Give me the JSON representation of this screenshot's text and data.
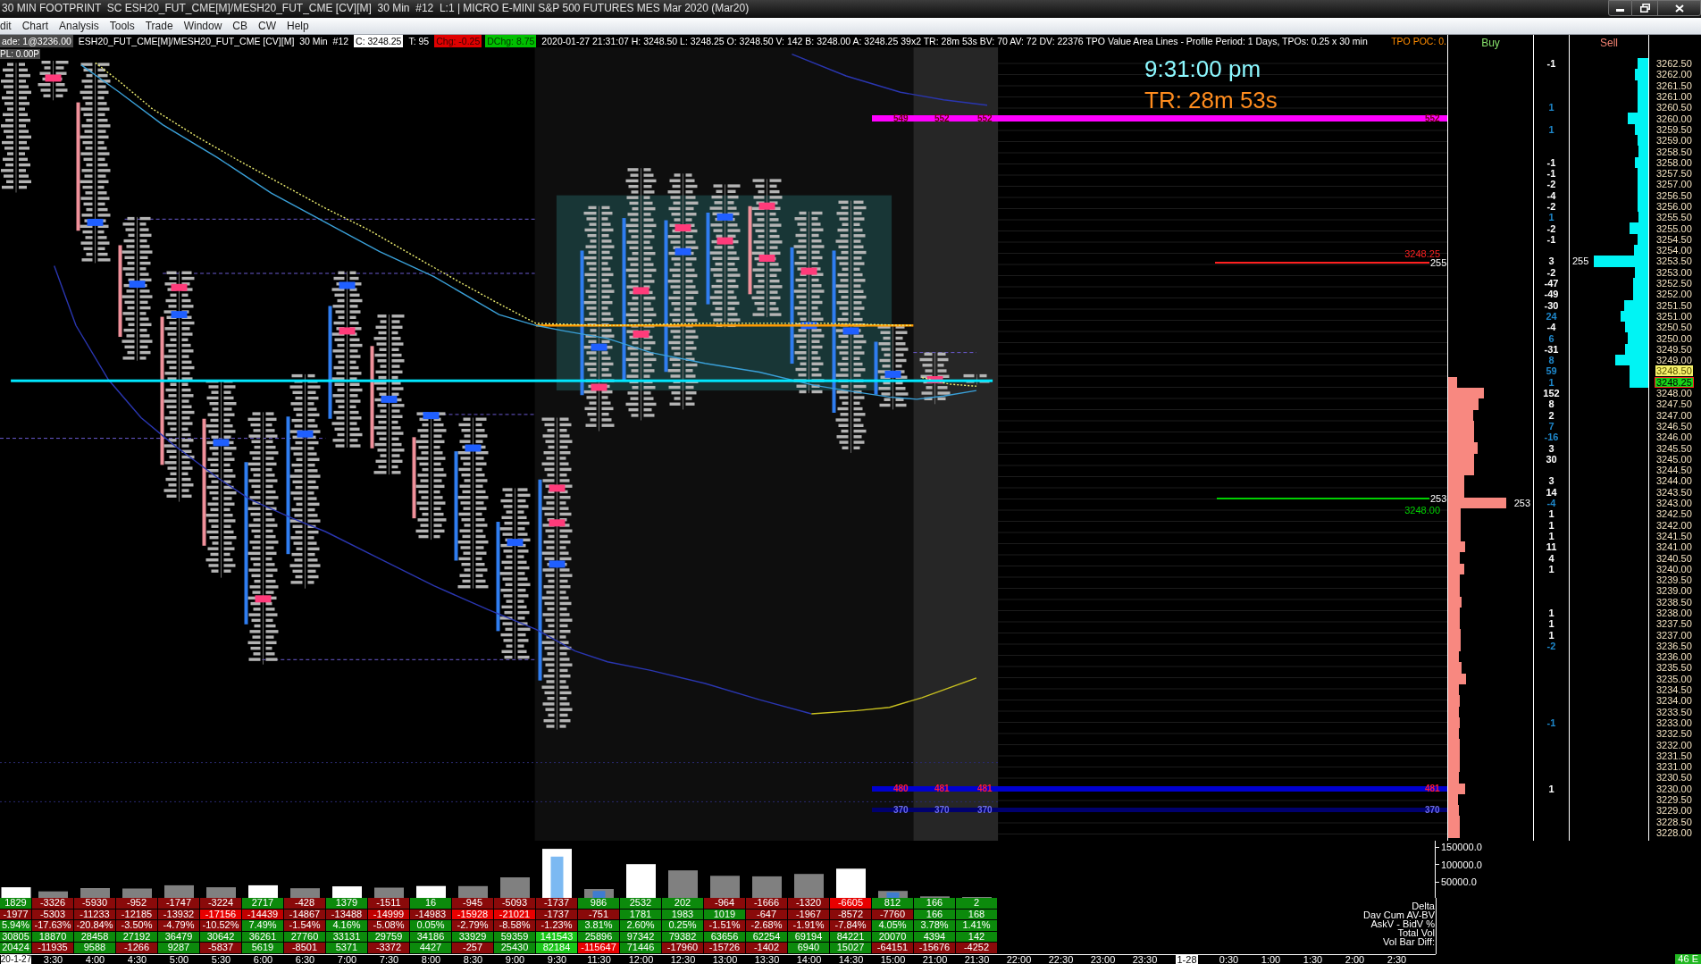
{
  "window": {
    "title": "30 MIN FOOTPRINT  SC ESH20_FUT_CME[M]/MESH20_FUT_CME [CV][M]  30 Min  #12  L:1 | MICRO E-MINI S&P 500 FUTURES MES Mar 2020 (Mar20)"
  },
  "menu": [
    "dit",
    "Chart",
    "Analysis",
    "Tools",
    "Trade",
    "Window",
    "CB",
    "CW",
    "Help"
  ],
  "chart_header": [
    {
      "kind": "trade",
      "text": "ade: 1@3236.00"
    },
    {
      "kind": "plain",
      "text": "ESH20_FUT_CME[M]/MESH20_FUT_CME [CV][M]  30 Min  #12"
    },
    {
      "kind": "close",
      "text": "C: 3248.25"
    },
    {
      "kind": "plain",
      "text": "T: 95"
    },
    {
      "kind": "down",
      "text": "Chg: -0.25"
    },
    {
      "kind": "up",
      "text": "DChg: 8.75"
    },
    {
      "kind": "plain",
      "text": "2020-01-27 21:31:07 H: 3248.50 L: 3248.25 O: 3248.50 V: 142 B: 3248.00 A: 3248.25 39x2 TR: 28m 53s BV: 70 AV: 72 DV: 22376 TPO Value Area Lines - Profile Period: 1 Days, TPOs: 0.25 x 30 min"
    },
    {
      "kind": "poc",
      "text": "TPO POC: 0."
    }
  ],
  "chart": {
    "pl": "PL: 0.00P",
    "clock": "9:31:00 pm",
    "timer": "TR: 28m 53s",
    "zones": [
      {
        "kind": "high",
        "color": "#ff00ff",
        "labels": [
          "549",
          "552",
          "552",
          "552"
        ]
      },
      {
        "kind": "low",
        "color": "#0000d0",
        "labels": [
          "480",
          "481",
          "481",
          "481"
        ]
      },
      {
        "kind": "lower",
        "color": "#00006e",
        "labels": [
          "370",
          "370",
          "370",
          "370"
        ]
      }
    ],
    "levels": [
      {
        "kind": "upper",
        "price": "3248.25",
        "count": "255",
        "color": "#ff2020"
      },
      {
        "kind": "lower",
        "price": "3248.00",
        "count": "253",
        "color": "#00d000"
      }
    ]
  },
  "ladder": {
    "buy_header": "Buy",
    "sell_header": "Sell",
    "rows": [
      {
        "price": "3262.50",
        "kind": "price",
        "sell": {
          "level": 0.14
        },
        "delta": {
          "text": "-1",
          "color": "#ffffff"
        }
      },
      {
        "price": "3262.00",
        "kind": "price",
        "sell": {
          "level": 0.17
        }
      },
      {
        "price": "3261.50",
        "kind": "price",
        "sell": {
          "level": 0.14
        }
      },
      {
        "price": "3261.00",
        "kind": "price",
        "sell": {
          "level": 0.14
        }
      },
      {
        "price": "3260.50",
        "kind": "price",
        "sell": {
          "level": 0.14
        },
        "delta": {
          "text": "1",
          "color": "#1e88cc"
        }
      },
      {
        "price": "3260.00",
        "kind": "price",
        "sell": {
          "level": 0.26
        }
      },
      {
        "price": "3259.50",
        "kind": "price",
        "sell": {
          "level": 0.17
        },
        "delta": {
          "text": "1",
          "color": "#1e88cc"
        }
      },
      {
        "price": "3259.00",
        "kind": "price",
        "sell": {
          "level": 0.14
        }
      },
      {
        "price": "3258.50",
        "kind": "price",
        "sell": {
          "level": 0.13
        }
      },
      {
        "price": "3258.00",
        "kind": "price",
        "sell": {
          "level": 0.17
        },
        "delta": {
          "text": "-1",
          "color": "#ffffff"
        }
      },
      {
        "price": "3257.50",
        "kind": "price",
        "sell": {
          "level": 0.14
        },
        "delta": {
          "text": "-1",
          "color": "#ffffff"
        }
      },
      {
        "price": "3257.00",
        "kind": "price",
        "sell": {
          "level": 0.14
        },
        "delta": {
          "text": "-2",
          "color": "#ffffff"
        }
      },
      {
        "price": "3256.50",
        "kind": "price",
        "sell": {
          "level": 0.14
        },
        "delta": {
          "text": "-4",
          "color": "#ffffff"
        }
      },
      {
        "price": "3256.00",
        "kind": "price",
        "sell": {
          "level": 0.14
        },
        "delta": {
          "text": "-2",
          "color": "#ffffff"
        }
      },
      {
        "price": "3255.50",
        "kind": "price",
        "sell": {
          "level": 0.13
        },
        "delta": {
          "text": "1",
          "color": "#1e88cc"
        }
      },
      {
        "price": "3255.00",
        "kind": "price",
        "sell": {
          "level": 0.24
        },
        "delta": {
          "text": "-2",
          "color": "#ffffff"
        }
      },
      {
        "price": "3254.50",
        "kind": "price",
        "sell": {
          "level": 0.14
        },
        "delta": {
          "text": "-1",
          "color": "#ffffff"
        }
      },
      {
        "price": "3254.00",
        "kind": "price",
        "sell": {
          "level": 0.18
        }
      },
      {
        "price": "3253.50",
        "kind": "price",
        "sell": {
          "level": 0.69
        },
        "sell_volume": "255",
        "delta": {
          "text": "3",
          "color": "#ffffff"
        }
      },
      {
        "price": "3253.00",
        "kind": "price",
        "sell": {
          "level": 0.17
        },
        "delta": {
          "text": "-2",
          "color": "#ffffff"
        }
      },
      {
        "price": "3252.50",
        "kind": "price",
        "sell": {
          "level": 0.19
        },
        "delta": {
          "text": "-47",
          "color": "#ffffff"
        }
      },
      {
        "price": "3252.00",
        "kind": "price",
        "sell": {
          "level": 0.19
        },
        "delta": {
          "text": "-49",
          "color": "#ffffff"
        }
      },
      {
        "price": "3251.50",
        "kind": "price",
        "sell": {
          "level": 0.31
        },
        "delta": {
          "text": "-30",
          "color": "#ffffff"
        }
      },
      {
        "price": "3251.00",
        "kind": "price",
        "sell": {
          "level": 0.35
        },
        "delta": {
          "text": "24",
          "color": "#1e88cc"
        }
      },
      {
        "price": "3250.50",
        "kind": "price",
        "sell": {
          "level": 0.3
        },
        "delta": {
          "text": "-4",
          "color": "#ffffff"
        }
      },
      {
        "price": "3250.00",
        "kind": "price",
        "sell": {
          "level": 0.26
        },
        "delta": {
          "text": "6",
          "color": "#1e88cc"
        }
      },
      {
        "price": "3249.50",
        "kind": "price",
        "sell": {
          "level": 0.29
        },
        "delta": {
          "text": "-31",
          "color": "#ffffff"
        }
      },
      {
        "price": "3249.00",
        "kind": "price",
        "sell": {
          "level": 0.42
        },
        "delta": {
          "text": "8",
          "color": "#1e88cc"
        }
      },
      {
        "price": "3248.50",
        "kind": "ask",
        "sell": {
          "level": 0.24
        },
        "delta": {
          "text": "59",
          "color": "#1e88cc"
        }
      },
      {
        "price": "3248.25",
        "kind": "last",
        "sell": {
          "level": 0.24
        },
        "buy": {
          "level": 0.1
        },
        "delta": {
          "text": "1",
          "color": "#1e88cc"
        }
      },
      {
        "price": "3248.00",
        "kind": "price",
        "buy": {
          "level": 0.42
        },
        "delta": {
          "text": "152",
          "color": "#ffffff"
        }
      },
      {
        "price": "3247.50",
        "kind": "price",
        "buy": {
          "level": 0.36
        },
        "delta": {
          "text": "8",
          "color": "#ffffff"
        }
      },
      {
        "price": "3247.00",
        "kind": "price",
        "buy": {
          "level": 0.29
        },
        "delta": {
          "text": "2",
          "color": "#ffffff"
        }
      },
      {
        "price": "3246.50",
        "kind": "price",
        "buy": {
          "level": 0.31
        },
        "delta": {
          "text": "7",
          "color": "#1e88cc"
        }
      },
      {
        "price": "3246.00",
        "kind": "price",
        "buy": {
          "level": 0.31
        },
        "delta": {
          "text": "-16",
          "color": "#1e88cc"
        }
      },
      {
        "price": "3245.50",
        "kind": "price",
        "buy": {
          "level": 0.35
        },
        "delta": {
          "text": "3",
          "color": "#ffffff"
        }
      },
      {
        "price": "3245.00",
        "kind": "price",
        "buy": {
          "level": 0.31
        },
        "delta": {
          "text": "30",
          "color": "#ffffff"
        }
      },
      {
        "price": "3244.50",
        "kind": "price",
        "buy": {
          "level": 0.31
        }
      },
      {
        "price": "3244.00",
        "kind": "price",
        "buy": {
          "level": 0.19
        },
        "delta": {
          "text": "3",
          "color": "#ffffff"
        }
      },
      {
        "price": "3243.50",
        "kind": "price",
        "buy": {
          "level": 0.19
        },
        "delta": {
          "text": "14",
          "color": "#ffffff"
        }
      },
      {
        "price": "3243.00",
        "kind": "price",
        "buy": {
          "level": 0.68
        },
        "buy_volume": "253",
        "delta": {
          "text": "-4",
          "color": "#1e88cc"
        }
      },
      {
        "price": "3242.50",
        "kind": "price",
        "buy": {
          "level": 0.15
        },
        "delta": {
          "text": "1",
          "color": "#ffffff"
        }
      },
      {
        "price": "3242.00",
        "kind": "price",
        "buy": {
          "level": 0.15
        },
        "delta": {
          "text": "1",
          "color": "#ffffff"
        }
      },
      {
        "price": "3241.50",
        "kind": "price",
        "buy": {
          "level": 0.15
        },
        "delta": {
          "text": "1",
          "color": "#ffffff"
        }
      },
      {
        "price": "3241.00",
        "kind": "price",
        "buy": {
          "level": 0.2
        },
        "delta": {
          "text": "11",
          "color": "#ffffff"
        }
      },
      {
        "price": "3240.50",
        "kind": "price",
        "buy": {
          "level": 0.14
        },
        "delta": {
          "text": "4",
          "color": "#ffffff"
        }
      },
      {
        "price": "3240.00",
        "kind": "price",
        "buy": {
          "level": 0.19
        },
        "delta": {
          "text": "1",
          "color": "#ffffff"
        }
      },
      {
        "price": "3239.50",
        "kind": "price",
        "buy": {
          "level": 0.14
        }
      },
      {
        "price": "3239.00",
        "kind": "price",
        "buy": {
          "level": 0.14
        }
      },
      {
        "price": "3238.50",
        "kind": "price",
        "buy": {
          "level": 0.16
        }
      },
      {
        "price": "3238.00",
        "kind": "price",
        "buy": {
          "level": 0.14
        },
        "delta": {
          "text": "1",
          "color": "#ffffff"
        }
      },
      {
        "price": "3237.50",
        "kind": "price",
        "buy": {
          "level": 0.14
        },
        "delta": {
          "text": "1",
          "color": "#ffffff"
        }
      },
      {
        "price": "3237.00",
        "kind": "price",
        "buy": {
          "level": 0.15
        },
        "delta": {
          "text": "1",
          "color": "#ffffff"
        }
      },
      {
        "price": "3236.50",
        "kind": "price",
        "buy": {
          "level": 0.15
        },
        "delta": {
          "text": "-2",
          "color": "#1e88cc"
        }
      },
      {
        "price": "3236.00",
        "kind": "price",
        "buy": {
          "level": 0.13
        }
      },
      {
        "price": "3235.50",
        "kind": "price",
        "buy": {
          "level": 0.16
        }
      },
      {
        "price": "3235.00",
        "kind": "price",
        "buy": {
          "level": 0.21
        }
      },
      {
        "price": "3234.50",
        "kind": "price",
        "buy": {
          "level": 0.13
        }
      },
      {
        "price": "3234.00",
        "kind": "price",
        "buy": {
          "level": 0.14
        }
      },
      {
        "price": "3233.50",
        "kind": "price",
        "buy": {
          "level": 0.13
        }
      },
      {
        "price": "3233.00",
        "kind": "price",
        "buy": {
          "level": 0.14
        },
        "delta": {
          "text": "-1",
          "color": "#1e88cc"
        }
      },
      {
        "price": "3232.50",
        "kind": "price",
        "buy": {
          "level": 0.13
        }
      },
      {
        "price": "3232.00",
        "kind": "price",
        "buy": {
          "level": 0.14
        }
      },
      {
        "price": "3231.50",
        "kind": "price",
        "buy": {
          "level": 0.14
        }
      },
      {
        "price": "3231.00",
        "kind": "price",
        "buy": {
          "level": 0.14
        }
      },
      {
        "price": "3230.50",
        "kind": "price",
        "buy": {
          "level": 0.13
        }
      },
      {
        "price": "3230.00",
        "kind": "price",
        "buy": {
          "level": 0.2
        },
        "delta": {
          "text": "1",
          "color": "#ffffff"
        }
      },
      {
        "price": "3229.50",
        "kind": "price",
        "buy": {
          "level": 0.12
        }
      },
      {
        "price": "3229.00",
        "kind": "price",
        "buy": {
          "level": 0.13
        }
      },
      {
        "price": "3228.50",
        "kind": "price",
        "buy": {
          "level": 0.14
        }
      },
      {
        "price": "3228.00",
        "kind": "price",
        "buy": {
          "level": 0.14
        }
      }
    ]
  },
  "volume_axis": [
    "150000.0",
    "100000.0",
    "50000.0"
  ],
  "table": {
    "rows": [
      {
        "label": "Delta",
        "cells": [
          {
            "text": "1829",
            "color": "#0c8a0c"
          },
          {
            "text": "-3326",
            "color": "#8a0a0a"
          },
          {
            "text": "-5930",
            "color": "#8a0a0a"
          },
          {
            "text": "-952",
            "color": "#8a0a0a"
          },
          {
            "text": "-1747",
            "color": "#8a0a0a"
          },
          {
            "text": "-3224",
            "color": "#8a0a0a"
          },
          {
            "text": "2717",
            "color": "#0c8a0c"
          },
          {
            "text": "-428",
            "color": "#8a0a0a"
          },
          {
            "text": "1379",
            "color": "#0c8a0c"
          },
          {
            "text": "-1511",
            "color": "#8a0a0a"
          },
          {
            "text": "16",
            "color": "#0c8a0c"
          },
          {
            "text": "-945",
            "color": "#8a0a0a"
          },
          {
            "text": "-5093",
            "color": "#8a0a0a"
          },
          {
            "text": "-1737",
            "color": "#8a0a0a"
          },
          {
            "text": "986",
            "color": "#0c8a0c"
          },
          {
            "text": "2532",
            "color": "#0c8a0c"
          },
          {
            "text": "202",
            "color": "#0c8a0c"
          },
          {
            "text": "-964",
            "color": "#8a0a0a"
          },
          {
            "text": "-1666",
            "color": "#8a0a0a"
          },
          {
            "text": "-1320",
            "color": "#8a0a0a"
          },
          {
            "text": "-6605",
            "color": "#e80000"
          },
          {
            "text": "812",
            "color": "#0c8a0c"
          },
          {
            "text": "166",
            "color": "#0c8a0c"
          },
          {
            "text": "2",
            "color": "#0c8a0c"
          }
        ]
      },
      {
        "label": "Dav Cum AV-BV",
        "cells": [
          {
            "text": "-1977",
            "color": "#8a0a0a"
          },
          {
            "text": "-5303",
            "color": "#8a0a0a"
          },
          {
            "text": "-11233",
            "color": "#8a0a0a"
          },
          {
            "text": "-12185",
            "color": "#8a0a0a"
          },
          {
            "text": "-13932",
            "color": "#8a0a0a"
          },
          {
            "text": "-17156",
            "color": "#e80000"
          },
          {
            "text": "-14439",
            "color": "#c00000"
          },
          {
            "text": "-14867",
            "color": "#8a0a0a"
          },
          {
            "text": "-13488",
            "color": "#8a0a0a"
          },
          {
            "text": "-14999",
            "color": "#c00000"
          },
          {
            "text": "-14983",
            "color": "#8a0a0a"
          },
          {
            "text": "-15928",
            "color": "#e80000"
          },
          {
            "text": "-21021",
            "color": "#e80000"
          },
          {
            "text": "-1737",
            "color": "#8a0a0a"
          },
          {
            "text": "-751",
            "color": "#8a0a0a"
          },
          {
            "text": "1781",
            "color": "#0c8a0c"
          },
          {
            "text": "1983",
            "color": "#0c8a0c"
          },
          {
            "text": "1019",
            "color": "#0c8a0c"
          },
          {
            "text": "-647",
            "color": "#8a0a0a"
          },
          {
            "text": "-1967",
            "color": "#8a0a0a"
          },
          {
            "text": "-8572",
            "color": "#8a0a0a"
          },
          {
            "text": "-7760",
            "color": "#8a0a0a"
          },
          {
            "text": "166",
            "color": "#0c8a0c"
          },
          {
            "text": "168",
            "color": "#0c8a0c"
          }
        ]
      },
      {
        "label": "AskV - BidV %",
        "cells": [
          {
            "text": "5.94%",
            "color": "#0c8a0c"
          },
          {
            "text": "-17.63%",
            "color": "#8a0a0a"
          },
          {
            "text": "-20.84%",
            "color": "#8a0a0a"
          },
          {
            "text": "-3.50%",
            "color": "#8a0a0a"
          },
          {
            "text": "-4.79%",
            "color": "#8a0a0a"
          },
          {
            "text": "-10.52%",
            "color": "#8a0a0a"
          },
          {
            "text": "7.49%",
            "color": "#0c8a0c"
          },
          {
            "text": "-1.54%",
            "color": "#8a0a0a"
          },
          {
            "text": "4.16%",
            "color": "#0c8a0c"
          },
          {
            "text": "-5.08%",
            "color": "#8a0a0a"
          },
          {
            "text": "0.05%",
            "color": "#0c8a0c"
          },
          {
            "text": "-2.79%",
            "color": "#8a0a0a"
          },
          {
            "text": "-8.58%",
            "color": "#8a0a0a"
          },
          {
            "text": "-1.23%",
            "color": "#8a0a0a"
          },
          {
            "text": "3.81%",
            "color": "#0c8a0c"
          },
          {
            "text": "2.60%",
            "color": "#0c8a0c"
          },
          {
            "text": "0.25%",
            "color": "#0c8a0c"
          },
          {
            "text": "-1.51%",
            "color": "#8a0a0a"
          },
          {
            "text": "-2.68%",
            "color": "#8a0a0a"
          },
          {
            "text": "-1.91%",
            "color": "#8a0a0a"
          },
          {
            "text": "-7.84%",
            "color": "#8a0a0a"
          },
          {
            "text": "4.05%",
            "color": "#0c8a0c"
          },
          {
            "text": "3.78%",
            "color": "#0c8a0c"
          },
          {
            "text": "1.41%",
            "color": "#0c8a0c"
          }
        ]
      },
      {
        "label": "Total Vol",
        "cells": [
          {
            "text": "30805",
            "color": "#0c8a0c"
          },
          {
            "text": "18870",
            "color": "#0c8a0c"
          },
          {
            "text": "28458",
            "color": "#0c8a0c"
          },
          {
            "text": "27192",
            "color": "#0c8a0c"
          },
          {
            "text": "36479",
            "color": "#0c8a0c"
          },
          {
            "text": "30642",
            "color": "#0c8a0c"
          },
          {
            "text": "36261",
            "color": "#0c8a0c"
          },
          {
            "text": "27760",
            "color": "#0c8a0c"
          },
          {
            "text": "33131",
            "color": "#0c8a0c"
          },
          {
            "text": "29759",
            "color": "#0c8a0c"
          },
          {
            "text": "34186",
            "color": "#0c8a0c"
          },
          {
            "text": "33929",
            "color": "#0c8a0c"
          },
          {
            "text": "59359",
            "color": "#0c8a0c"
          },
          {
            "text": "141543",
            "color": "#19c819"
          },
          {
            "text": "25896",
            "color": "#0c8a0c"
          },
          {
            "text": "97342",
            "color": "#0c8a0c"
          },
          {
            "text": "79382",
            "color": "#0c8a0c"
          },
          {
            "text": "63656",
            "color": "#0c8a0c"
          },
          {
            "text": "62254",
            "color": "#0c8a0c"
          },
          {
            "text": "69194",
            "color": "#0c8a0c"
          },
          {
            "text": "84221",
            "color": "#0c8a0c"
          },
          {
            "text": "20070",
            "color": "#0c8a0c"
          },
          {
            "text": "4394",
            "color": "#0c8a0c"
          },
          {
            "text": "142",
            "color": "#0c8a0c"
          }
        ]
      },
      {
        "label": "Vol Bar Diff:",
        "cells": [
          {
            "text": "20424",
            "color": "#0c8a0c"
          },
          {
            "text": "-11935",
            "color": "#8a0a0a"
          },
          {
            "text": "9588",
            "color": "#0c8a0c"
          },
          {
            "text": "-1266",
            "color": "#8a0a0a"
          },
          {
            "text": "9287",
            "color": "#0c8a0c"
          },
          {
            "text": "-5837",
            "color": "#8a0a0a"
          },
          {
            "text": "5619",
            "color": "#0c8a0c"
          },
          {
            "text": "-8501",
            "color": "#8a0a0a"
          },
          {
            "text": "5371",
            "color": "#0c8a0c"
          },
          {
            "text": "-3372",
            "color": "#8a0a0a"
          },
          {
            "text": "4427",
            "color": "#0c8a0c"
          },
          {
            "text": "-257",
            "color": "#8a0a0a"
          },
          {
            "text": "25430",
            "color": "#0c8a0c"
          },
          {
            "text": "82184",
            "color": "#19c819"
          },
          {
            "text": "-115647",
            "color": "#e80000"
          },
          {
            "text": "71446",
            "color": "#0c8a0c"
          },
          {
            "text": "-17960",
            "color": "#8a0a0a"
          },
          {
            "text": "-15726",
            "color": "#8a0a0a"
          },
          {
            "text": "-1402",
            "color": "#8a0a0a"
          },
          {
            "text": "6940",
            "color": "#0c8a0c"
          },
          {
            "text": "15027",
            "color": "#0c8a0c"
          },
          {
            "text": "-64151",
            "color": "#8a0a0a"
          },
          {
            "text": "-15676",
            "color": "#8a0a0a"
          },
          {
            "text": "-4252",
            "color": "#8a0a0a"
          }
        ]
      }
    ]
  },
  "time_axis": [
    {
      "kind": "date",
      "text": "20-1-27"
    },
    {
      "kind": "time",
      "text": "3:30"
    },
    {
      "kind": "time",
      "text": "4:00"
    },
    {
      "kind": "time",
      "text": "4:30"
    },
    {
      "kind": "time",
      "text": "5:00"
    },
    {
      "kind": "time",
      "text": "5:30"
    },
    {
      "kind": "time",
      "text": "6:00"
    },
    {
      "kind": "time",
      "text": "6:30"
    },
    {
      "kind": "time",
      "text": "7:00"
    },
    {
      "kind": "time",
      "text": "7:30"
    },
    {
      "kind": "time",
      "text": "8:00"
    },
    {
      "kind": "time",
      "text": "8:30"
    },
    {
      "kind": "time",
      "text": "9:00"
    },
    {
      "kind": "time",
      "text": "9:30"
    },
    {
      "kind": "time",
      "text": "11:30"
    },
    {
      "kind": "time",
      "text": "12:00"
    },
    {
      "kind": "time",
      "text": "12:30"
    },
    {
      "kind": "time",
      "text": "13:00"
    },
    {
      "kind": "time",
      "text": "13:30"
    },
    {
      "kind": "time",
      "text": "14:00"
    },
    {
      "kind": "time",
      "text": "14:30"
    },
    {
      "kind": "time",
      "text": "15:00"
    },
    {
      "kind": "time",
      "text": "21:00"
    },
    {
      "kind": "time",
      "text": "21:30"
    },
    {
      "kind": "time",
      "text": "22:00"
    },
    {
      "kind": "time",
      "text": "22:30"
    },
    {
      "kind": "time",
      "text": "23:00"
    },
    {
      "kind": "time",
      "text": "23:30"
    },
    {
      "kind": "date",
      "text": "1-28"
    },
    {
      "kind": "time",
      "text": "0:30"
    },
    {
      "kind": "time",
      "text": "1:00"
    },
    {
      "kind": "time",
      "text": "1:30"
    },
    {
      "kind": "time",
      "text": "2:00"
    },
    {
      "kind": "time",
      "text": "2:30"
    }
  ],
  "status": {
    "badge": "46 E"
  }
}
